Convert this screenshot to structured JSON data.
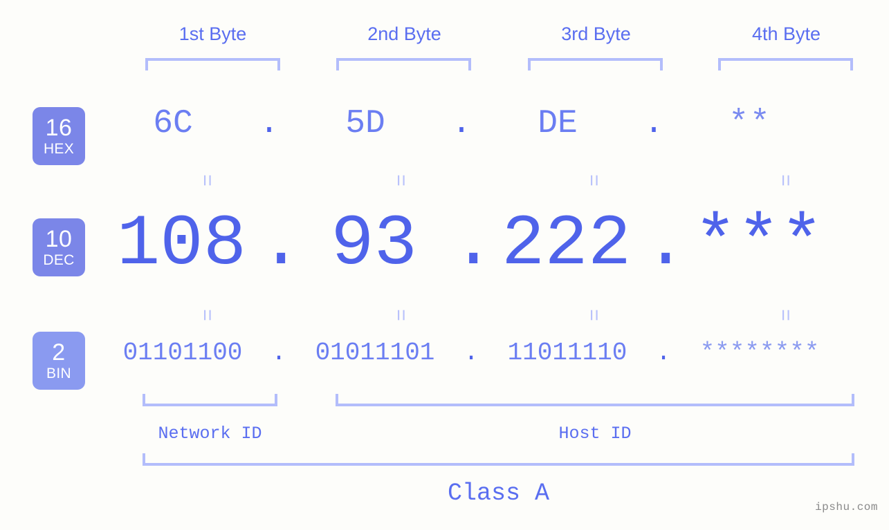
{
  "background_color": "#fdfdfa",
  "accent_color": "#5a6ef0",
  "accent_light_color": "#b3bdfb",
  "badge_color": "#7b86e8",
  "badge_color_bin": "#8a9af0",
  "byte_headers": [
    {
      "label": "1st Byte"
    },
    {
      "label": "2nd Byte"
    },
    {
      "label": "3rd Byte"
    },
    {
      "label": "4th Byte"
    }
  ],
  "rows": {
    "hex": {
      "badge_number": "16",
      "badge_name": "HEX",
      "values": [
        "6C",
        "5D",
        "DE",
        "**"
      ],
      "separator": "."
    },
    "dec": {
      "badge_number": "10",
      "badge_name": "DEC",
      "values": [
        "108",
        "93",
        "222",
        "***"
      ],
      "separator": "."
    },
    "bin": {
      "badge_number": "2",
      "badge_name": "BIN",
      "values": [
        "01101100",
        "01011101",
        "11011110",
        "********"
      ],
      "separator": "."
    }
  },
  "equals_glyph": "=",
  "sections": {
    "network_id": "Network ID",
    "host_id": "Host ID",
    "class": "Class A"
  },
  "watermark": "ipshu.com"
}
